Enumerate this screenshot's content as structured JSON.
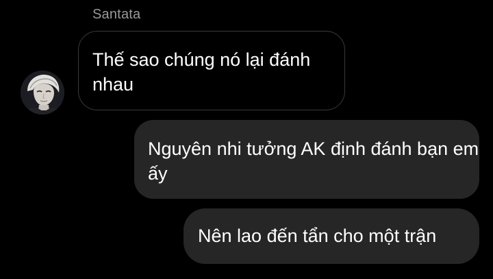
{
  "conversation": {
    "sender_name": "Santata",
    "messages": [
      {
        "direction": "incoming",
        "text": "Thế sao chúng nó lại đánh nhau"
      },
      {
        "direction": "outgoing",
        "text": "Nguyên nhi tưởng AK  định đánh bạn em ấy"
      },
      {
        "direction": "outgoing",
        "text": "Nên lao đến tẩn cho một trận"
      }
    ]
  },
  "colors": {
    "background": "#000000",
    "outgoing_bubble": "#262626",
    "incoming_border": "#3a3a3a",
    "sender_name": "#9a9a9a",
    "text": "#ffffff"
  },
  "icons": {
    "avatar": "profile-photo-icon"
  }
}
